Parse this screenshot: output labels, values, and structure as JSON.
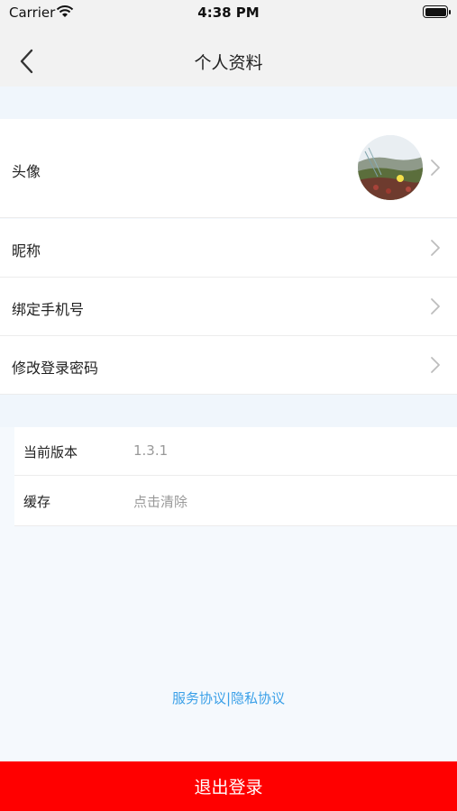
{
  "status_bar": {
    "carrier": "Carrier",
    "time": "4:38 PM"
  },
  "nav": {
    "title": "个人资料",
    "back_icon": "chevron-left-icon"
  },
  "profile": {
    "rows": [
      {
        "label": "头像"
      },
      {
        "label": "昵称"
      },
      {
        "label": "绑定手机号"
      },
      {
        "label": "修改登录密码"
      }
    ]
  },
  "info": {
    "version_label": "当前版本",
    "version_value": "1.3.1",
    "cache_label": "缓存",
    "cache_value": "点击清除"
  },
  "footer": {
    "service_agreement": "服务协议",
    "separator": "|",
    "privacy_agreement": "隐私协议",
    "link_color": "#3aa0e8"
  },
  "logout": {
    "label": "退出登录",
    "color": "#ff0000"
  }
}
